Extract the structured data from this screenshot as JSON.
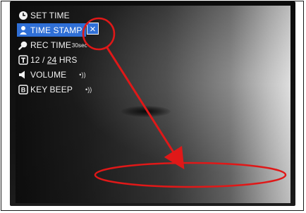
{
  "menu": {
    "items": [
      {
        "name": "set-time",
        "icon": "clock-icon",
        "label": "SET TIME"
      },
      {
        "name": "time-stamp",
        "icon": "person-icon",
        "label": "TIME STAMP",
        "selected": true
      },
      {
        "name": "rec-time",
        "icon": "magnifier-icon",
        "label": "REC TIME",
        "value": "30sec"
      },
      {
        "name": "hour-format",
        "icon": "t-box-icon",
        "label_12": "12 /",
        "label_24": "24",
        "label_unit": "HRS"
      },
      {
        "name": "volume",
        "icon": "speaker-icon",
        "label": "VOLUME",
        "value": "•))"
      },
      {
        "name": "key-beep",
        "icon": "b-box-icon",
        "label": "KEY BEEP",
        "value": "•))"
      }
    ],
    "close_glyph": "×"
  },
  "colors": {
    "highlight": "#2f6fd6",
    "annotation": "#e01818",
    "menu_text": "#f2f2f2"
  }
}
